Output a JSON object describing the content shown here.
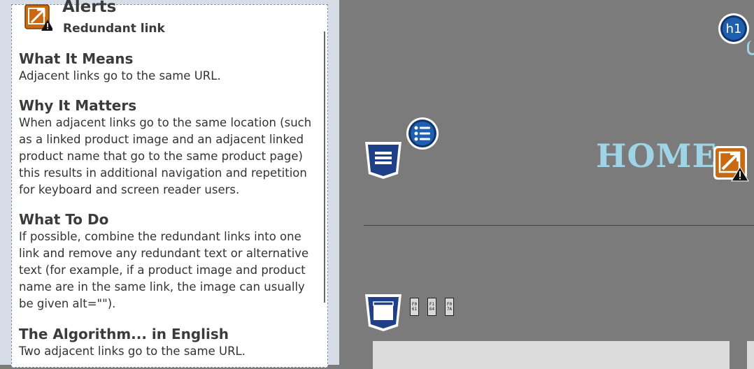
{
  "panel": {
    "title": "Alerts",
    "subtitle": "Redundant link",
    "sections": [
      {
        "heading": "What It Means",
        "body": "Adjacent links go to the same URL."
      },
      {
        "heading": "Why It Matters",
        "body": "When adjacent links go to the same location (such as a linked product image and an adjacent linked product name that go to the same product page) this results in additional navigation and repetition for keyboard and screen reader users."
      },
      {
        "heading": "What To Do",
        "body": "If possible, combine the redundant links into one link and remove any redundant text or alternative text (for example, if a product image and product name are in the same link, the image can usually be given alt=\"\")."
      },
      {
        "heading": "The Algorithm... in English",
        "body": "Two adjacent links go to the same URL."
      }
    ]
  },
  "page": {
    "home_text": "HOME",
    "h1_badge": "h1",
    "chips": [
      "F0 61",
      "F1 64",
      "F0 7A"
    ]
  },
  "icons": {
    "alert": "redundant-link-alert-icon",
    "h1": "heading-h1-icon",
    "list": "list-icon",
    "html5_nav": "html5-nav-region-icon",
    "html5_header": "html5-header-region-icon"
  },
  "colors": {
    "alert_orange": "#c86a12",
    "region_blue": "#1f3f86",
    "page_bg": "#7b7b7b",
    "home_text": "#9fd4e6"
  }
}
